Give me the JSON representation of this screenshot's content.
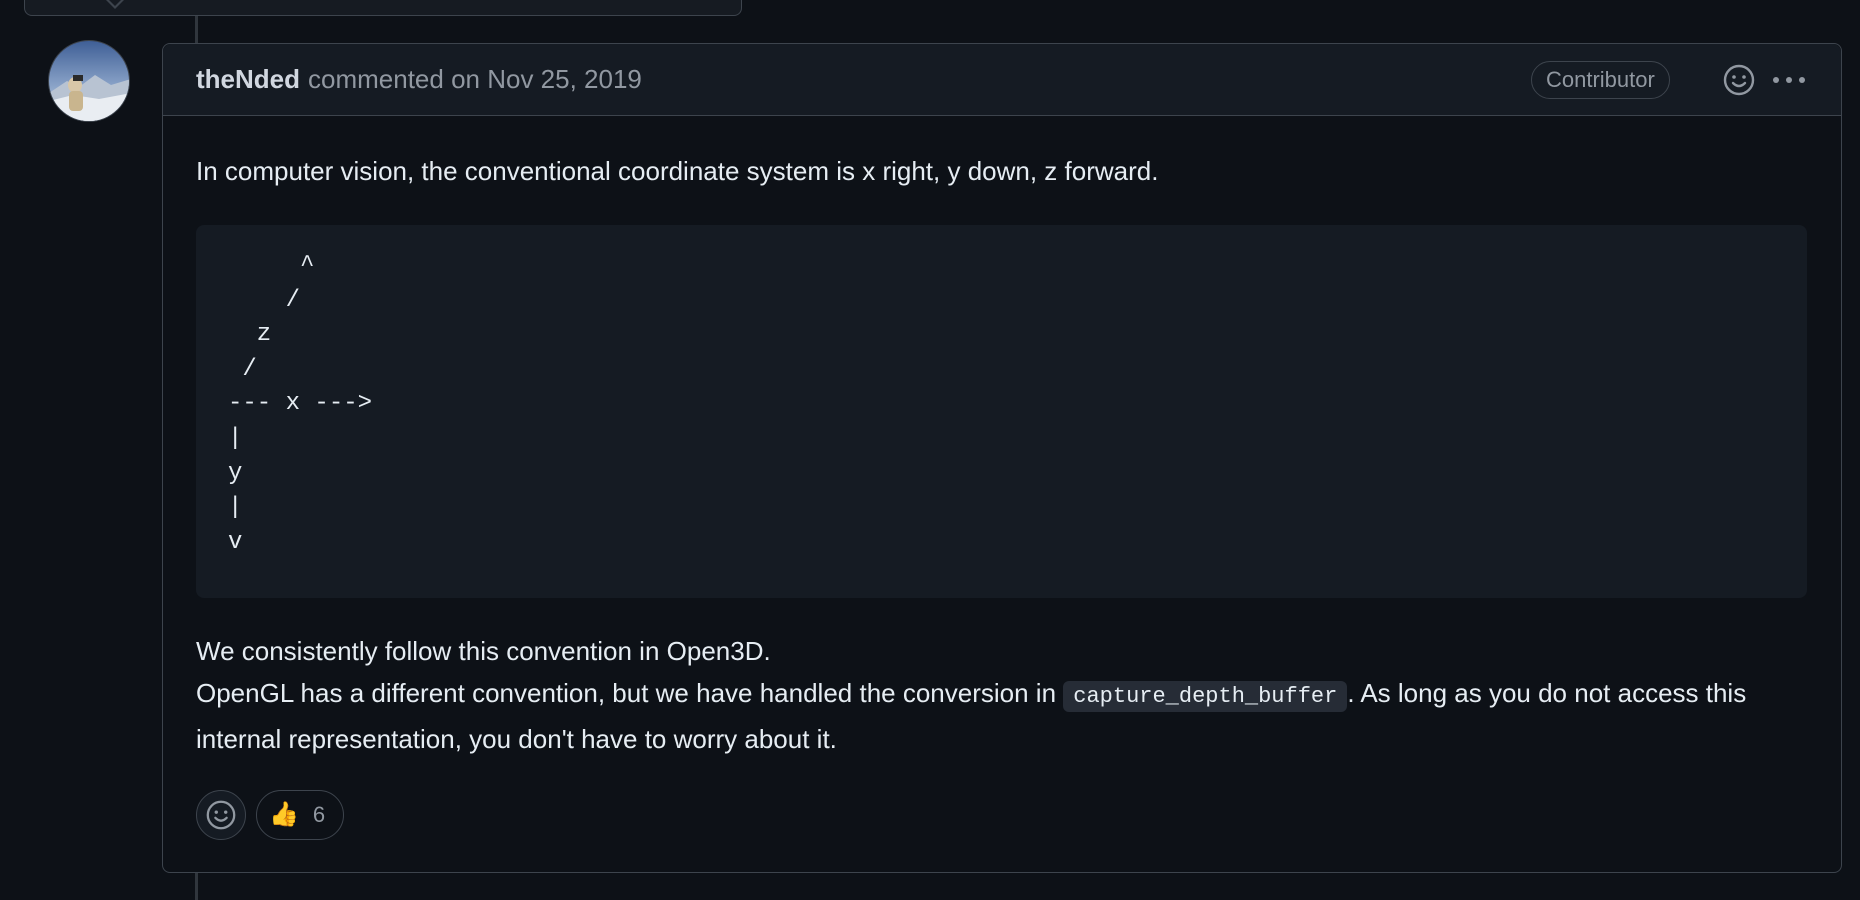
{
  "comment": {
    "author": "theNded",
    "meta": "commented on Nov 25, 2019",
    "badge": "Contributor",
    "paragraph1": "In computer vision, the conventional coordinate system is x right, y down, z forward.",
    "code": "     ^\n    /\n  z\n /\n--- x --->\n|\ny\n|\nv",
    "paragraph2_line1": "We consistently follow this convention in Open3D.",
    "paragraph2_before_code": "OpenGL has a different convention, but we have handled the conversion in ",
    "inline_code": "capture_depth_buffer",
    "paragraph2_after_code": ". As long as you do not access this internal representation, you don't have to worry about it."
  },
  "reactions": [
    {
      "emoji": "👍",
      "count": "6"
    }
  ],
  "icons": {
    "header_emoji": "smiley-icon",
    "header_more": "kebab-horizontal-icon",
    "add_reaction": "smiley-icon"
  },
  "colors": {
    "background": "#0d1117",
    "header_bg": "#151b23",
    "border": "#3d444d",
    "muted_text": "#9198a1"
  }
}
